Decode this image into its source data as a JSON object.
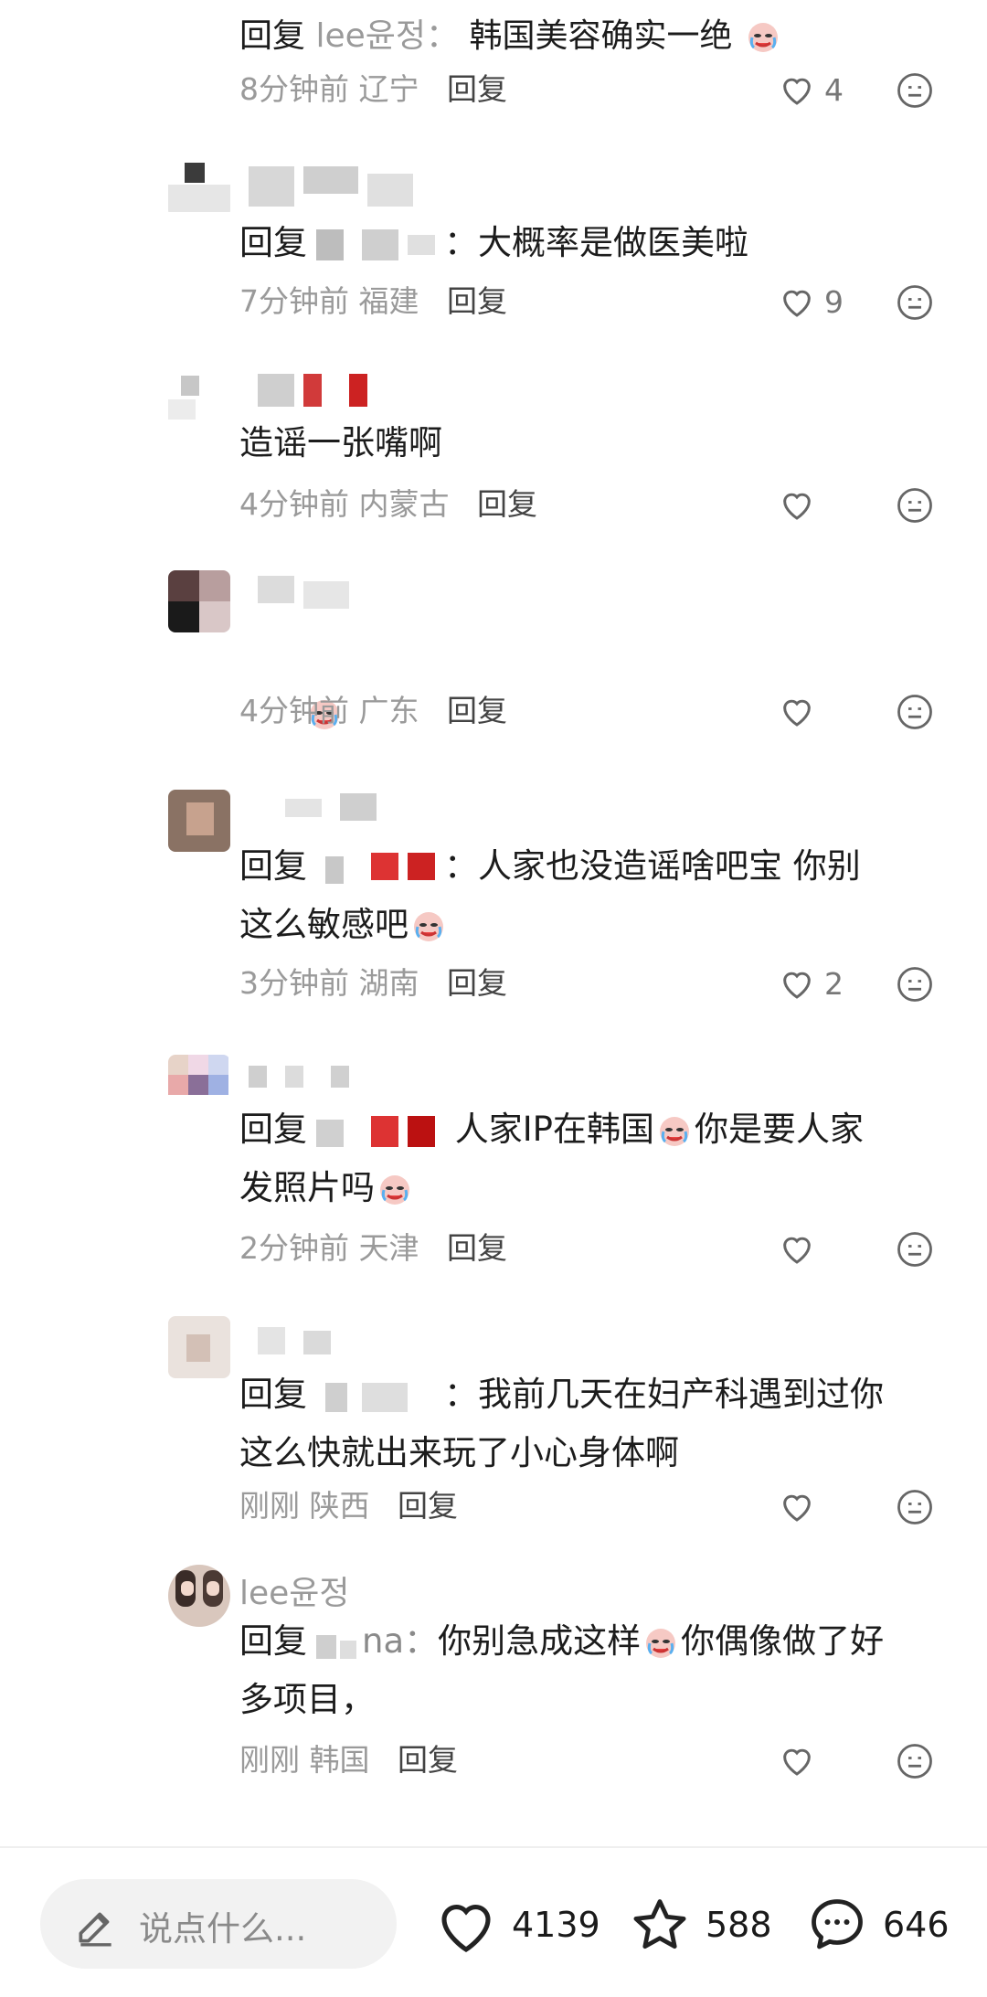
{
  "top_partial": {
    "prefix": "回复",
    "user": "lee윤정：",
    "text": "韩国美容确实一绝"
  },
  "comments": [
    {
      "time": "8分钟前",
      "region": "辽宁",
      "reply_label": "回复",
      "likes": "4"
    },
    {
      "reply_prefix": "回复",
      "text": "：大概率是做医美啦",
      "time": "7分钟前",
      "region": "福建",
      "reply_label": "回复",
      "likes": "9"
    },
    {
      "text": "造谣一张嘴啊",
      "time": "4分钟前",
      "region": "内蒙古",
      "reply_label": "回复",
      "likes": ""
    },
    {
      "time": "4分钟前",
      "region": "广东",
      "reply_label": "回复",
      "likes": ""
    },
    {
      "reply_prefix": "回复",
      "line1": "：人家也没造谣啥吧宝 你别",
      "line2": "这么敏感吧",
      "time": "3分钟前",
      "region": "湖南",
      "reply_label": "回复",
      "likes": "2"
    },
    {
      "reply_prefix": "回复",
      "line1": " 人家IP在韩国",
      "line1b": "你是要人家",
      "line2": "发照片吗",
      "time": "2分钟前",
      "region": "天津",
      "reply_label": "回复",
      "likes": ""
    },
    {
      "reply_prefix": "回复",
      "line1": "：我前几天在妇产科遇到过你",
      "line2": "这么快就出来玩了小心身体啊",
      "time": "刚刚",
      "region": "陕西",
      "reply_label": "回复",
      "likes": ""
    },
    {
      "username": "lee윤정",
      "reply_prefix": "回复",
      "reply_target": "na：",
      "line1a": "你别急成这样",
      "line1b": "你偶像做了好",
      "line2": "多项目，",
      "time": "刚刚",
      "region": "韩国",
      "reply_label": "回复",
      "likes": ""
    }
  ],
  "bottom_bar": {
    "input_placeholder": "说点什么...",
    "likes": "4139",
    "favorites": "588",
    "comments": "646"
  },
  "icons": {
    "like": "heart-icon",
    "dislike": "dislike-face-icon",
    "emoji": "crying-laughing-emoji-icon",
    "pencil": "pencil-icon",
    "star": "star-icon",
    "comment": "comment-bubble-icon"
  }
}
